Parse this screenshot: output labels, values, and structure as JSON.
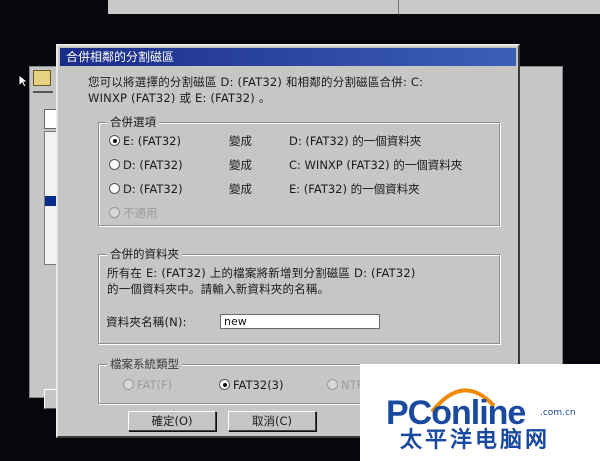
{
  "dialog": {
    "title": "合併相鄰的分割磁區",
    "intro_line1": "您可以將選擇的分割磁區 D: (FAT32) 和相鄰的分割磁區合併: C:",
    "intro_line2": "WINXP (FAT32) 或 E: (FAT32) 。"
  },
  "merge_options": {
    "title": "合併選項",
    "options": [
      {
        "source": "E: (FAT32)",
        "verb": "變成",
        "result": "D: (FAT32) 的一個資料夾",
        "checked": true
      },
      {
        "source": "D: (FAT32)",
        "verb": "變成",
        "result": "C: WINXP (FAT32) 的一個資料夾",
        "checked": false
      },
      {
        "source": "D: (FAT32)",
        "verb": "變成",
        "result": "E: (FAT32) 的一個資料夾",
        "checked": false
      }
    ],
    "disabled_option": "不適用"
  },
  "merge_folder": {
    "title": "合併的資料夾",
    "desc_line1": "所有在 E: (FAT32) 上的檔案將新增到分割磁區 D: (FAT32)",
    "desc_line2": "的一個資料夾中。請輸入新資料夾的名稱。",
    "name_label": "資料夾名稱(N):",
    "name_value": "new"
  },
  "fs_type": {
    "title": "檔案系統類型",
    "fat_label": "FAT(F)",
    "fat32_label": "FAT32(3)",
    "ntfs_label": "NTFS",
    "selected": "FAT32(3)"
  },
  "buttons": {
    "ok": "確定(O)",
    "cancel": "取消(C)"
  },
  "watermark": {
    "brand": "PConline",
    "domain": ".com.cn",
    "chinese": "太平洋电脑网"
  },
  "colors": {
    "title_bar": "#1a2c8a",
    "dialog_bg": "#c6c6c4",
    "watermark_blue": "#1a4aa0",
    "watermark_orange": "#f08a00"
  }
}
